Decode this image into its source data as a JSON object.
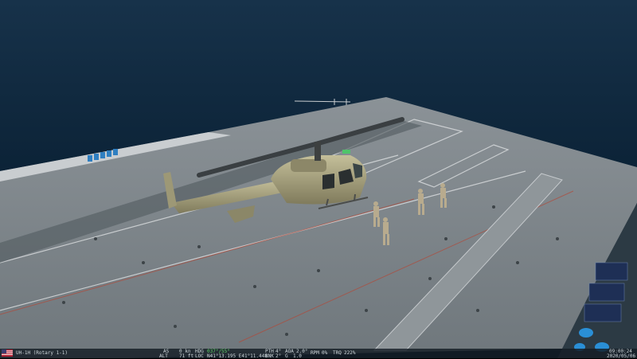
{
  "hud": {
    "unit_name": "UH-1H (Rotary 1-1)",
    "as_label": "AS",
    "as_value": "0 kn",
    "alt_label": "ALT",
    "alt_value": "71 ft",
    "hdg_label": "HDG",
    "hdg_value": "037°/55°",
    "loc_label": "LOC",
    "loc_value": "N41°13.195 E41°11.448",
    "pitch_label": "PTH",
    "pitch_value": "4°",
    "bank_label": "BNK",
    "bank_value": "2°",
    "aoa_label": "AOA",
    "aoa_value": "2.0°",
    "g_label": "G",
    "g_value": "1.0",
    "rpm_label": "RPM",
    "rpm_value": "0%",
    "trq_label": "TRQ",
    "trq_value": "222%",
    "time": "09:00:24",
    "date": "2020/05/06"
  },
  "colors": {
    "sea": "#0b2236",
    "deck": "#7a8287",
    "hud_bg": "#141c24",
    "helicopter": "#a29d7a"
  },
  "icons": {
    "flag": "us-flag-icon"
  }
}
